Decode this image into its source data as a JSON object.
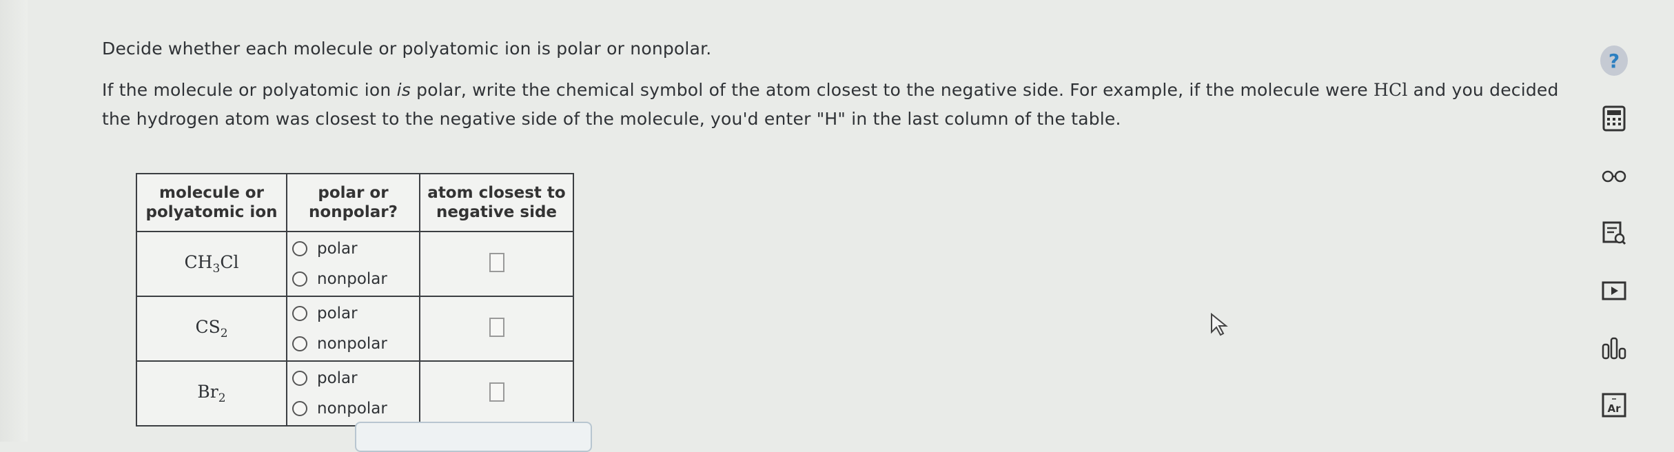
{
  "instructions": {
    "line1": "Decide whether each molecule or polyatomic ion is polar or nonpolar.",
    "line2_part1": "If the molecule or polyatomic ion ",
    "line2_is": "is",
    "line2_part2": " polar, write the chemical symbol of the atom closest to the negative side. For example, if the molecule were ",
    "example_molecule": "HCl",
    "line2_part3": " and you decided the hydrogen atom was closest to the negative side of the molecule, you'd enter \"H\" in the last column of the table."
  },
  "table": {
    "headers": [
      "molecule or polyatomic ion",
      "polar or nonpolar?",
      "atom closest to negative side"
    ],
    "rows": [
      {
        "formula_a": "CH",
        "sub_a": "3",
        "formula_b": "Cl",
        "sub_b": "",
        "opt1": "polar",
        "opt2": "nonpolar"
      },
      {
        "formula_a": "CS",
        "sub_a": "2",
        "formula_b": "",
        "sub_b": "",
        "opt1": "polar",
        "opt2": "nonpolar"
      },
      {
        "formula_a": "Br",
        "sub_a": "2",
        "formula_b": "",
        "sub_b": "",
        "opt1": "polar",
        "opt2": "nonpolar"
      }
    ]
  },
  "toolbar": {
    "help_label": "?",
    "icons": [
      "calculator-icon",
      "glasses-icon",
      "notes-icon",
      "video-icon",
      "chart-icon",
      "periodic-table-icon"
    ],
    "periodic_label": "Ar",
    "accent": "#2c7fc0"
  }
}
